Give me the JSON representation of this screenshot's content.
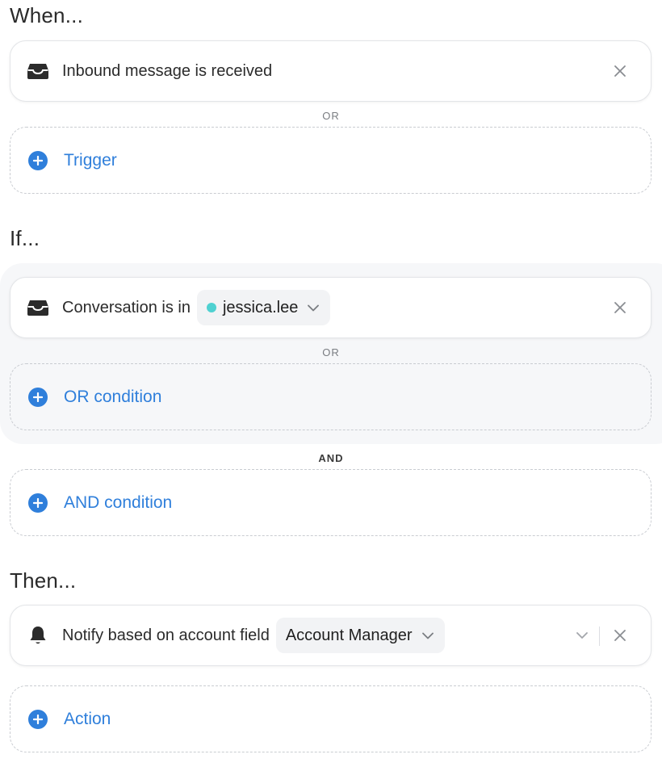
{
  "when": {
    "heading": "When...",
    "trigger_label": "Inbound message is received",
    "separator": "OR",
    "add_label": "Trigger"
  },
  "if": {
    "heading": "If...",
    "condition_prefix": "Conversation is in",
    "condition_value": "jessica.lee",
    "condition_dot_color": "#4fd1d1",
    "or_separator": "OR",
    "or_add_label": "OR condition",
    "and_separator": "AND",
    "and_add_label": "AND condition"
  },
  "then": {
    "heading": "Then...",
    "action_prefix": "Notify based on account field",
    "action_value": "Account Manager",
    "add_label": "Action"
  },
  "colors": {
    "accent": "#2f7fdb",
    "group_background": "#f6f7f9"
  }
}
